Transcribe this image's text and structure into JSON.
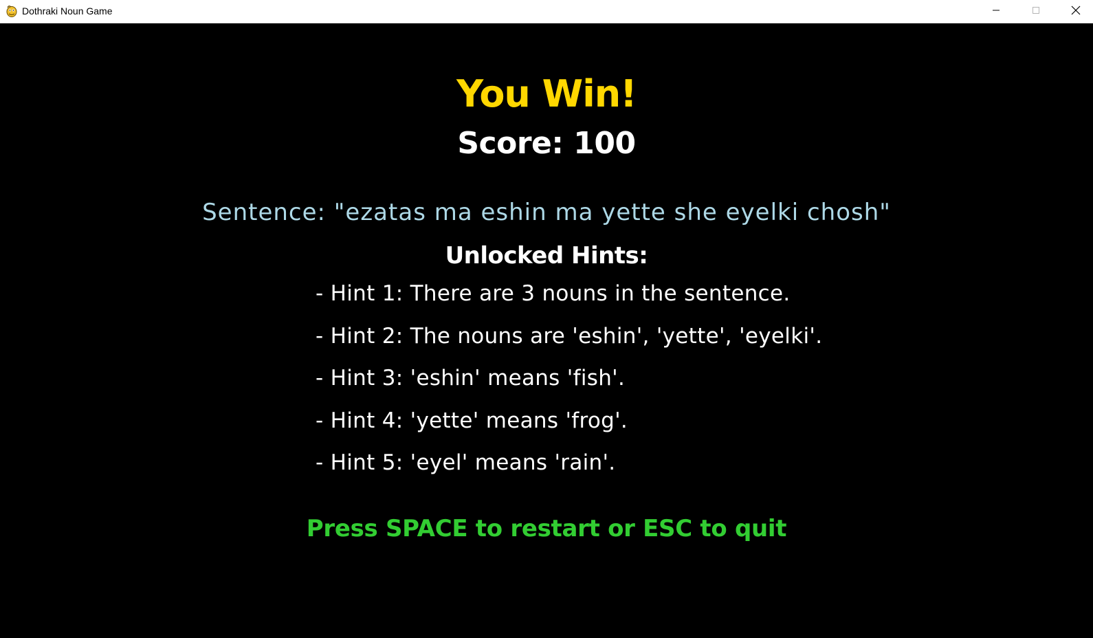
{
  "window": {
    "title": "Dothraki Noun Game",
    "app_icon": "pygame-snake-icon",
    "controls": {
      "minimize_icon": "minimize-icon",
      "maximize_icon": "maximize-icon",
      "close_icon": "close-icon"
    }
  },
  "game": {
    "result_title": "You Win!",
    "score_text": "Score: 100",
    "sentence_text": "Sentence: \"ezatas ma eshin ma yette she eyelki chosh\"",
    "hints_heading": "Unlocked Hints:",
    "hints": [
      "- Hint 1: There are 3 nouns in the sentence.",
      "- Hint 2: The nouns are 'eshin', 'yette', 'eyelki'.",
      "- Hint 3: 'eshin' means 'fish'.",
      "- Hint 4: 'yette' means 'frog'.",
      "- Hint 5: 'eyel' means 'rain'."
    ],
    "prompt_text": "Press SPACE to restart or ESC to quit"
  },
  "colors": {
    "background": "#000000",
    "title_yellow": "#ffd700",
    "sentence_lightblue": "#add8e6",
    "prompt_green": "#32cd32",
    "text_white": "#ffffff"
  }
}
